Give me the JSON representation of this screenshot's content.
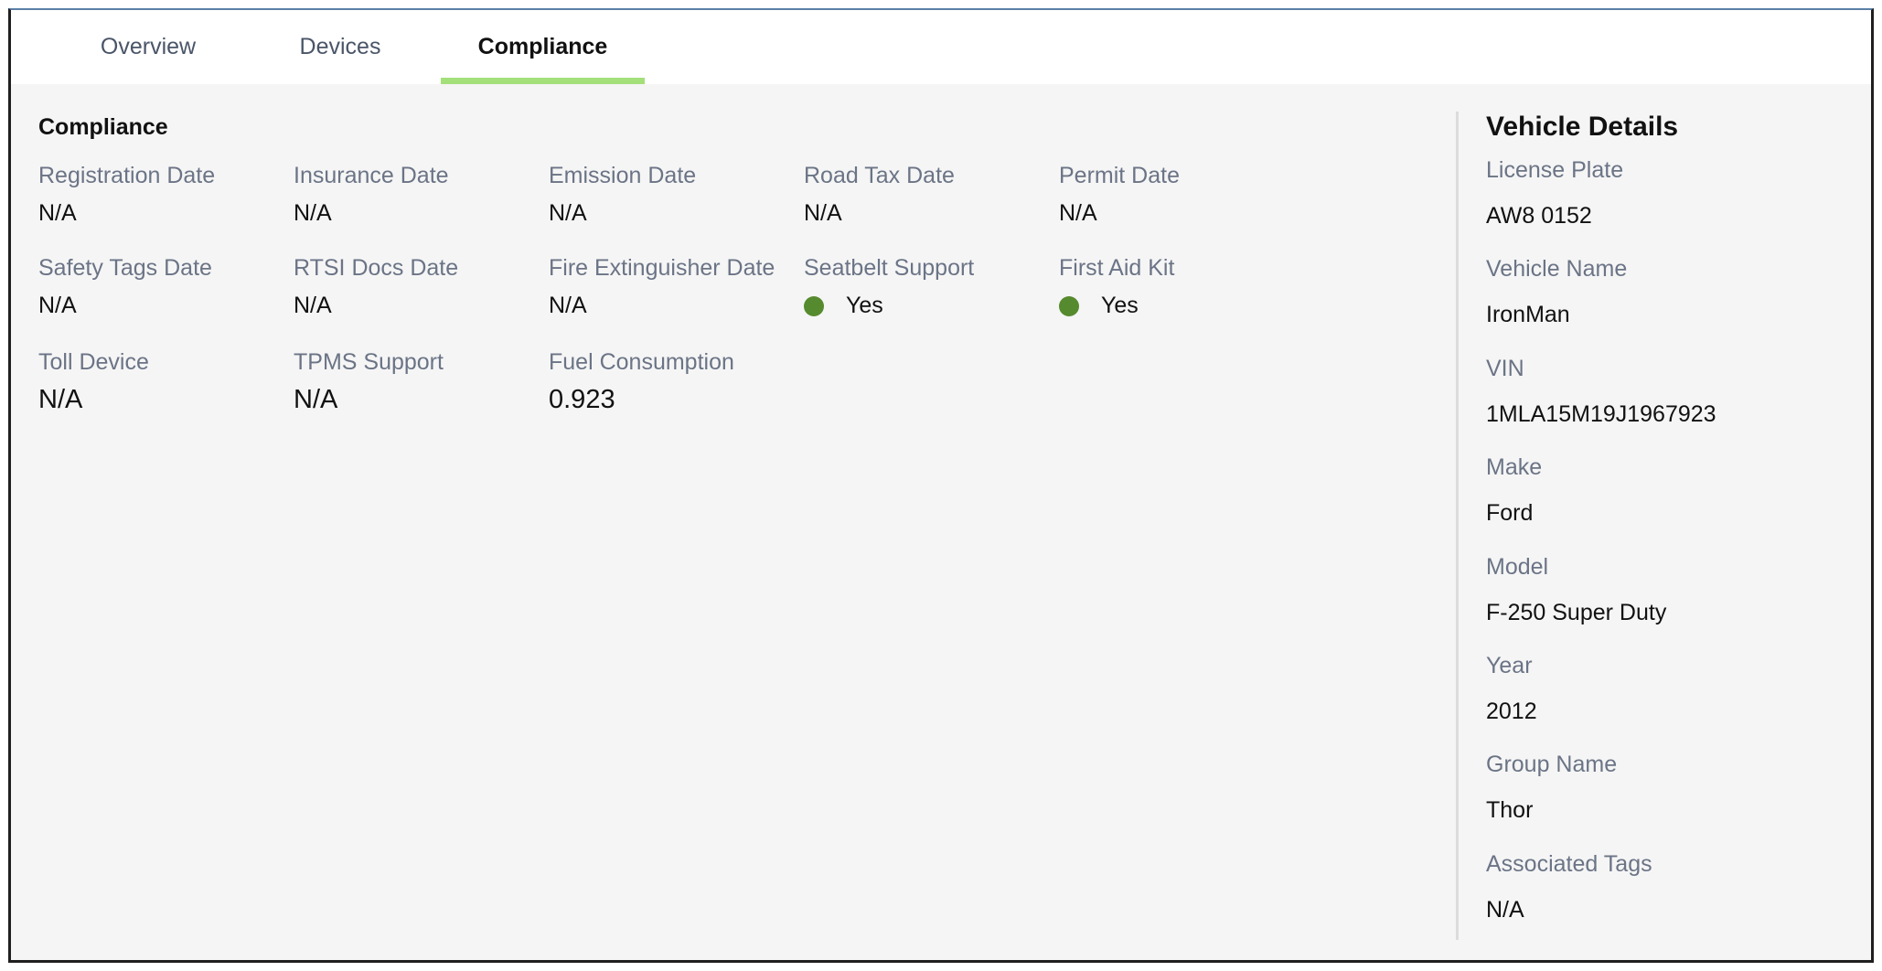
{
  "tabs": [
    {
      "label": "Overview"
    },
    {
      "label": "Devices"
    },
    {
      "label": "Compliance"
    }
  ],
  "compliance": {
    "title": "Compliance",
    "status_color": "#568a2e",
    "fields": [
      {
        "label": "Registration Date",
        "value": "N/A"
      },
      {
        "label": "Insurance Date",
        "value": "N/A"
      },
      {
        "label": "Emission Date",
        "value": "N/A"
      },
      {
        "label": "Road Tax Date",
        "value": "N/A"
      },
      {
        "label": "Permit Date",
        "value": "N/A"
      },
      {
        "label": "Safety Tags Date",
        "value": "N/A"
      },
      {
        "label": "RTSI Docs Date",
        "value": "N/A"
      },
      {
        "label": "Fire Extinguisher Date",
        "value": "N/A"
      },
      {
        "label": "Seatbelt Support",
        "value": "Yes"
      },
      {
        "label": "First Aid Kit",
        "value": "Yes"
      },
      {
        "label": "Toll Device",
        "value": "N/A"
      },
      {
        "label": "TPMS Support",
        "value": "N/A"
      },
      {
        "label": "Fuel Consumption",
        "value": "0.923"
      }
    ]
  },
  "vehicle_details": {
    "title": "Vehicle Details",
    "items": [
      {
        "label": "License Plate",
        "value": "AW8 0152"
      },
      {
        "label": "Vehicle Name",
        "value": "IronMan"
      },
      {
        "label": "VIN",
        "value": "1MLA15M19J1967923"
      },
      {
        "label": "Make",
        "value": "Ford"
      },
      {
        "label": "Model",
        "value": "F-250 Super Duty"
      },
      {
        "label": "Year",
        "value": "2012"
      },
      {
        "label": "Group Name",
        "value": "Thor"
      },
      {
        "label": "Associated Tags",
        "value": "N/A"
      }
    ]
  },
  "colors": {
    "active_tab_underline": "#a3e07a",
    "label_gray": "#6b7486"
  }
}
